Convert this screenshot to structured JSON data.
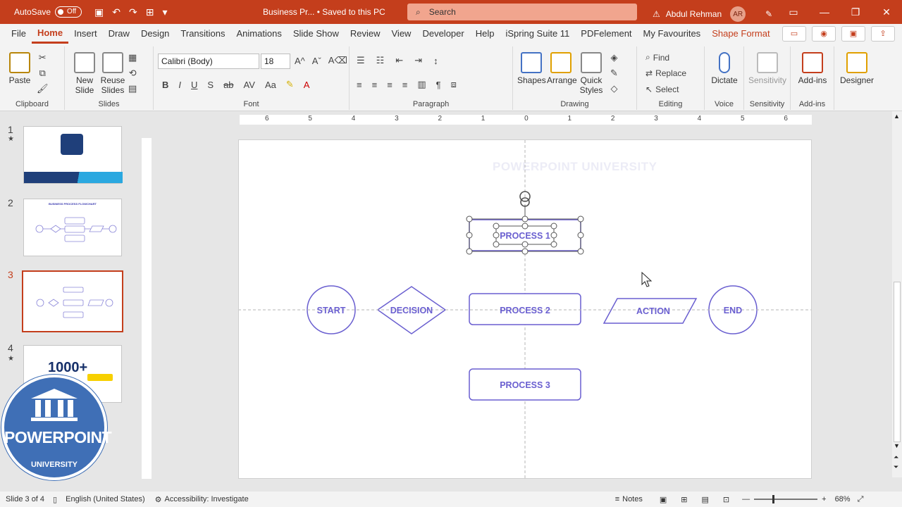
{
  "titlebar": {
    "autosave_label": "AutoSave",
    "autosave_state": "Off",
    "doc_title": "Business Pr... • Saved to this PC",
    "search_placeholder": "Search",
    "user_name": "Abdul Rehman",
    "user_initials": "AR"
  },
  "menu": {
    "tabs": [
      "File",
      "Home",
      "Insert",
      "Draw",
      "Design",
      "Transitions",
      "Animations",
      "Slide Show",
      "Review",
      "View",
      "Developer",
      "Help",
      "iSpring Suite 11",
      "PDFelement",
      "My Favourites",
      "Shape Format"
    ],
    "active": "Home"
  },
  "ribbon": {
    "clipboard": {
      "paste": "Paste",
      "label": "Clipboard"
    },
    "slides": {
      "new_slide": "New Slide",
      "reuse_slides": "Reuse Slides",
      "label": "Slides"
    },
    "font": {
      "family": "Calibri (Body)",
      "size": "18",
      "label": "Font"
    },
    "paragraph": {
      "label": "Paragraph"
    },
    "drawing": {
      "shapes": "Shapes",
      "arrange": "Arrange",
      "quick_styles": "Quick Styles",
      "label": "Drawing"
    },
    "editing": {
      "find": "Find",
      "replace": "Replace",
      "select": "Select",
      "label": "Editing"
    },
    "voice": {
      "dictate": "Dictate",
      "label": "Voice"
    },
    "sensitivity": {
      "btn": "Sensitivity",
      "label": "Sensitivity"
    },
    "addins": {
      "btn": "Add-ins",
      "label": "Add-ins"
    },
    "designer": {
      "btn": "Designer"
    }
  },
  "thumbnails": [
    {
      "num": "1"
    },
    {
      "num": "2",
      "title": "BUSINESS PROCESS FLOWCHART"
    },
    {
      "num": "3"
    },
    {
      "num": "4",
      "text": "1000+"
    }
  ],
  "slide": {
    "watermark": "POWERPOINT UNIVERSITY",
    "shapes": {
      "start": "START",
      "decision": "DECISION",
      "process1": "PROCESS 1",
      "process2": "PROCESS 2",
      "process3": "PROCESS 3",
      "action": "ACTION",
      "end": "END"
    },
    "accent": "#6a5fd0"
  },
  "ruler": {
    "h_ticks": [
      "6",
      "5",
      "4",
      "3",
      "2",
      "1",
      "0",
      "1",
      "2",
      "3",
      "4",
      "5",
      "6"
    ]
  },
  "logo": {
    "top": "POWERPOINT",
    "bottom": "UNIVERSITY"
  },
  "statusbar": {
    "slide_info": "Slide 3 of 4",
    "language": "English (United States)",
    "accessibility": "Accessibility: Investigate",
    "notes": "Notes",
    "zoom": "68%"
  }
}
